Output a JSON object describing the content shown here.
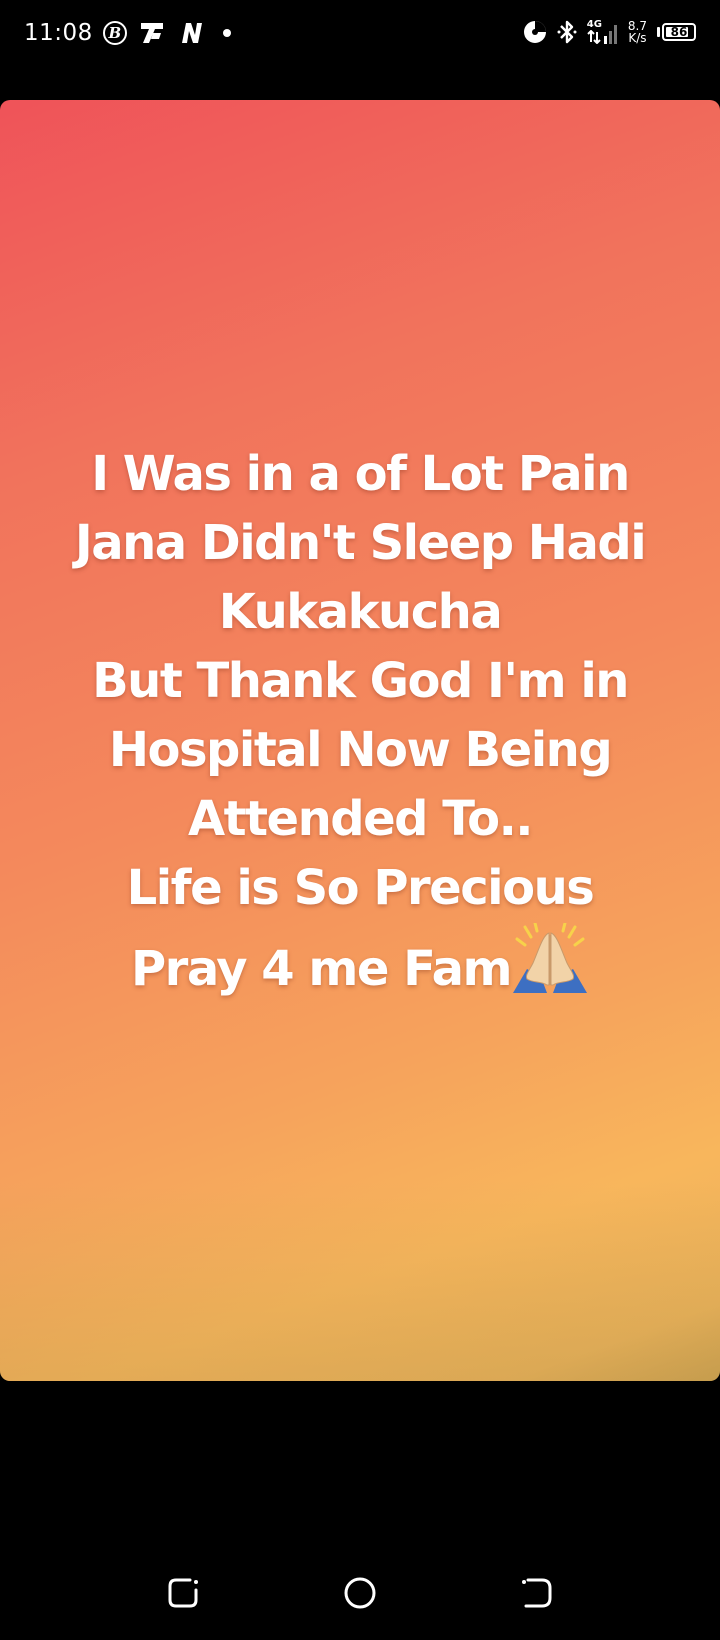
{
  "status_bar": {
    "time": "11:08",
    "circle_letter": "B",
    "net_4g": "4G",
    "net_speed_value": "8.7",
    "net_speed_unit": "K/s",
    "battery_percent": "86",
    "icons": [
      "b-circle-icon",
      "app-notification-icon",
      "netflix-n-icon",
      "notification-dot-icon",
      "data-saver-icon",
      "bluetooth-icon",
      "signal-icon",
      "battery-icon"
    ]
  },
  "story": {
    "lines": [
      "I Was in a of Lot Pain",
      "Jana Didn't Sleep Hadi",
      "Kukakucha",
      "But Thank God I'm in",
      "Hospital Now Being",
      "Attended To..",
      "Life is So Precious",
      "Pray 4 me Fam"
    ],
    "emoji": "praying-hands-icon",
    "colors": {
      "gradient_top": "#ef5359",
      "gradient_mid": "#f4895c",
      "gradient_bottom": "#f8b65c",
      "text": "#ffffff"
    }
  },
  "nav_bar": {
    "buttons": [
      "recents-button",
      "home-button",
      "back-button"
    ]
  }
}
